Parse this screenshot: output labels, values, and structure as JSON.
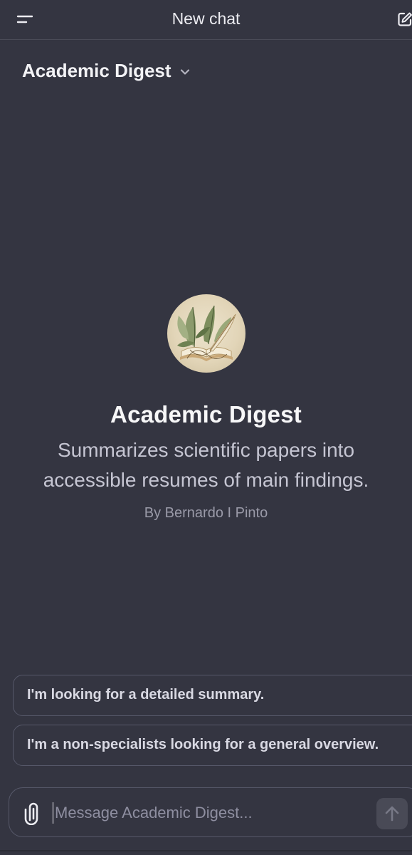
{
  "header": {
    "title": "New chat",
    "menu_icon": "hamburger-menu-icon",
    "new_chat_icon": "compose-icon"
  },
  "gpt_selector": {
    "label": "Academic Digest",
    "icon": "chevron-down-icon"
  },
  "gpt_profile": {
    "name": "Academic Digest",
    "description": "Summarizes scientific papers into accessible resumes of main findings.",
    "author": "By Bernardo I Pinto",
    "avatar": "book-and-quill-illustration"
  },
  "suggestions": [
    {
      "label": "I'm looking for a detailed summary."
    },
    {
      "label": "I'm a non-specialists looking for a general overview."
    }
  ],
  "composer": {
    "placeholder": "Message Academic Digest...",
    "value": "",
    "attach_icon": "paperclip-icon",
    "send_icon": "arrow-up-icon"
  },
  "colors": {
    "background": "#343541",
    "border": "#565869",
    "text_primary": "#ececf1",
    "text_secondary": "#c5c5d2",
    "text_muted": "#9a9aa8"
  }
}
